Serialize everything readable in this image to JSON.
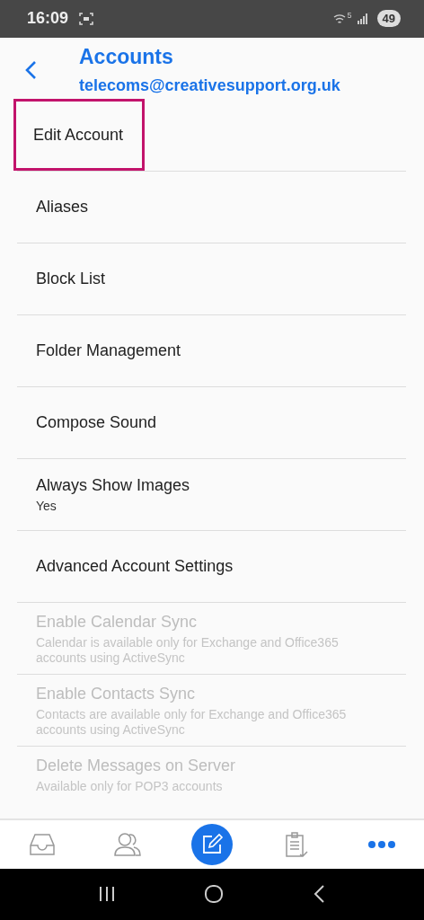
{
  "status_bar": {
    "time": "16:09",
    "battery": "49",
    "wifi_badge": "5"
  },
  "header": {
    "title": "Accounts",
    "subtitle": "telecoms@creativesupport.org.uk"
  },
  "items": [
    {
      "label": "Edit Account",
      "disabled": false,
      "highlighted": true
    },
    {
      "label": "Aliases",
      "disabled": false,
      "highlighted": false
    },
    {
      "label": "Block List",
      "disabled": false,
      "highlighted": false
    },
    {
      "label": "Folder Management",
      "disabled": false,
      "highlighted": false
    },
    {
      "label": "Compose Sound",
      "disabled": false,
      "highlighted": false
    },
    {
      "label": "Always Show Images",
      "detail": "Yes",
      "disabled": false,
      "highlighted": false
    },
    {
      "label": "Advanced Account Settings",
      "disabled": false,
      "highlighted": false
    },
    {
      "label": "Enable Calendar Sync",
      "detail": "Calendar is available only for Exchange and Office365 accounts using ActiveSync",
      "disabled": true,
      "highlighted": false
    },
    {
      "label": "Enable Contacts Sync",
      "detail": "Contacts are available only for Exchange and Office365 accounts using ActiveSync",
      "disabled": true,
      "highlighted": false
    },
    {
      "label": "Delete Messages on Server",
      "detail": "Available only for POP3 accounts",
      "disabled": true,
      "highlighted": false
    }
  ],
  "tab_bar": [
    {
      "kind": "inbox",
      "selected": false
    },
    {
      "kind": "contacts",
      "selected": false
    },
    {
      "kind": "compose",
      "selected": false
    },
    {
      "kind": "tasks",
      "selected": false
    },
    {
      "kind": "more",
      "selected": true
    }
  ]
}
